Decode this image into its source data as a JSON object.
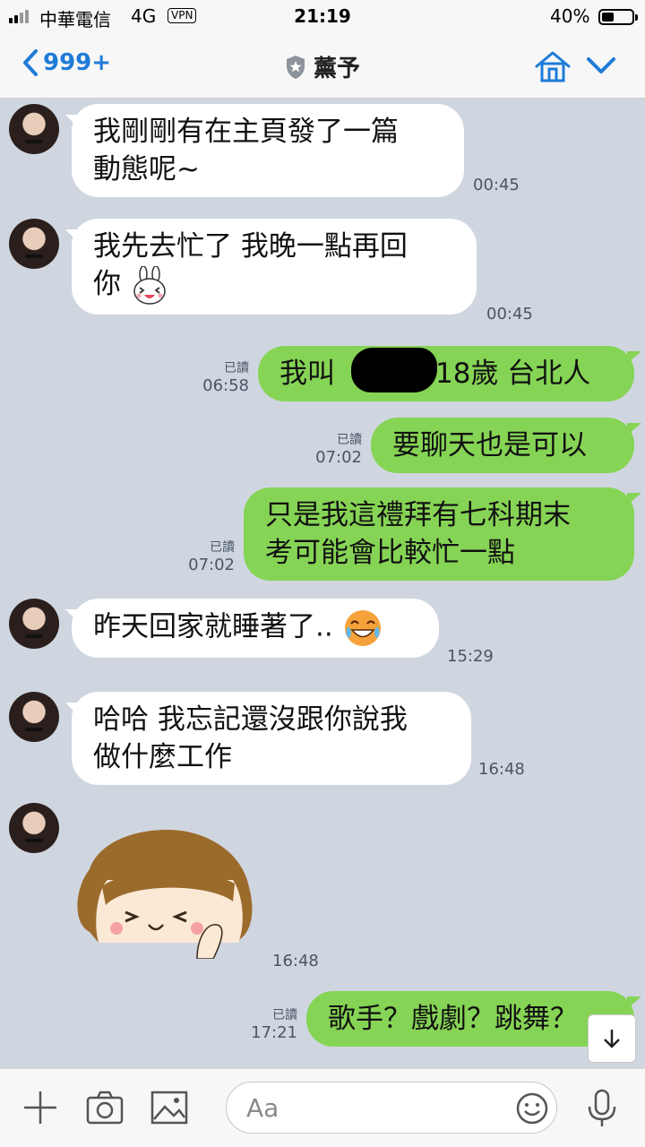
{
  "status_bar": {
    "carrier": "中華電信",
    "network": "4G",
    "vpn": "VPN",
    "time": "21:19",
    "battery_text": "40%",
    "battery_level": 0.4
  },
  "header": {
    "back_count": "999+",
    "title": "薰予"
  },
  "messages": [
    {
      "side": "in",
      "lines": [
        "我剛剛有在主頁發了一篇",
        "動態呢~"
      ],
      "time": "00:45"
    },
    {
      "side": "in",
      "lines": [
        "我先去忙了  我晚一點再回",
        "你"
      ],
      "emoji": "bunny-emoji",
      "time": "00:45"
    },
    {
      "side": "out",
      "text_before": "我叫",
      "text_after": "18歲 台北人",
      "read": "已讀",
      "time": "06:58"
    },
    {
      "side": "out",
      "lines": [
        "要聊天也是可以"
      ],
      "read": "已讀",
      "time": "07:02"
    },
    {
      "side": "out",
      "lines": [
        "只是我這禮拜有七科期末",
        "考可能會比較忙一點"
      ],
      "read": "已讀",
      "time": "07:02"
    },
    {
      "side": "in",
      "lines": [
        "昨天回家就睡著了.."
      ],
      "emoji": "laughing-emoji",
      "time": "15:29"
    },
    {
      "side": "in",
      "lines": [
        "哈哈 我忘記還沒跟你說我",
        "做什麼工作"
      ],
      "time": "16:48"
    },
    {
      "side": "in",
      "sticker": "girl-sticker",
      "time": "16:48"
    },
    {
      "side": "out",
      "lines": [
        "歌手？戲劇？跳舞？"
      ],
      "read": "已讀",
      "time": "17:21"
    }
  ],
  "input": {
    "placeholder": "Aa"
  },
  "colors": {
    "chat_bg": "#cfd6e0",
    "outgoing_bubble": "#86d455",
    "incoming_bubble": "#ffffff",
    "accent": "#1e7bd8"
  }
}
